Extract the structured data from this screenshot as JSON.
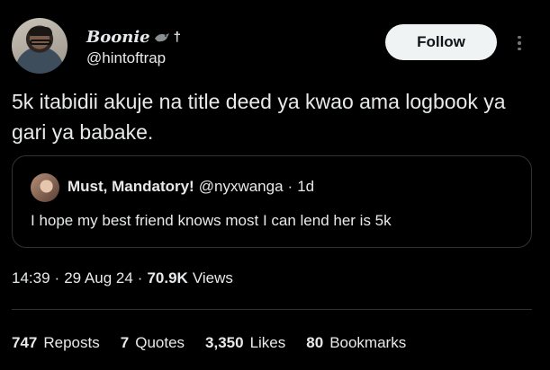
{
  "author": {
    "display_name": "Boonie",
    "name_suffix": "†",
    "handle": "@hintoftrap",
    "avatar_icon": "profile-photo"
  },
  "follow_label": "Follow",
  "more_icon": "ellipsis-vertical-icon",
  "tweet_text": "5k itabidii akuje na title deed ya kwao ama logbook ya gari ya babake.",
  "quote": {
    "display_name": "Must, Mandatory!",
    "handle": "@nyxwanga",
    "separator": "·",
    "time": "1d",
    "text": "I hope my best friend knows most I can lend her is 5k"
  },
  "meta": {
    "time": "14:39",
    "sep1": "·",
    "date": "29 Aug 24",
    "sep2": "·",
    "views_count": "70.9K",
    "views_label": "Views"
  },
  "stats": [
    {
      "count": "747",
      "label": "Reposts"
    },
    {
      "count": "7",
      "label": "Quotes"
    },
    {
      "count": "3,350",
      "label": "Likes"
    },
    {
      "count": "80",
      "label": "Bookmarks"
    }
  ],
  "colors": {
    "background": "#000000",
    "text": "#e7e9ea",
    "border": "#2f3336",
    "follow_bg": "#eff3f4"
  }
}
